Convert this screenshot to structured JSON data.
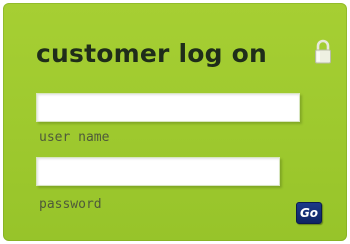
{
  "login": {
    "title": "customer log on",
    "username_label": "user name",
    "username_value": "",
    "password_label": "password",
    "password_value": "",
    "submit_label": "Go",
    "lock_icon": "padlock-icon"
  },
  "colors": {
    "panel_bg": "#a2cb30",
    "title_text": "#1f2d1a",
    "label_text": "#4f5a3a",
    "button_bg": "#1b3a8a"
  }
}
